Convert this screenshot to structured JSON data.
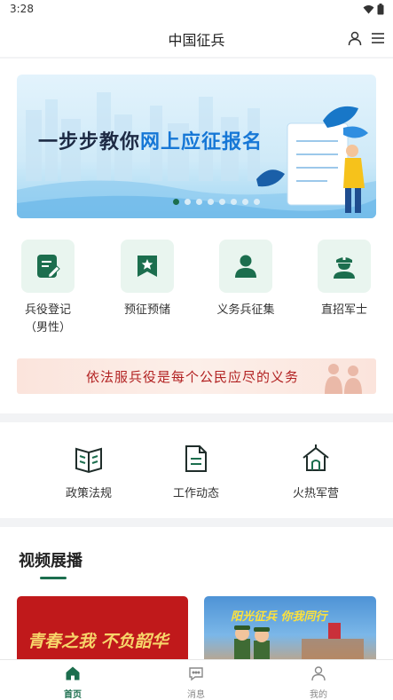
{
  "status_bar": {
    "time": "3:28"
  },
  "header": {
    "title": "中国征兵"
  },
  "banner": {
    "title_part1": "一步步教你",
    "title_part2": "网上应征报名"
  },
  "quick_links": [
    {
      "label": "兵役登记",
      "sub_label": "（男性）",
      "icon": "registration-edit-icon"
    },
    {
      "label": "预征预储",
      "icon": "bookmark-star-icon"
    },
    {
      "label": "义务兵征集",
      "icon": "soldier-person-icon"
    },
    {
      "label": "直招军士",
      "icon": "officer-cap-icon"
    }
  ],
  "slogan": {
    "text": "依法服兵役是每个公民应尽的义务"
  },
  "nav": [
    {
      "label": "政策法规",
      "icon": "book-icon"
    },
    {
      "label": "工作动态",
      "icon": "document-icon"
    },
    {
      "label": "火热军营",
      "icon": "barracks-house-icon"
    }
  ],
  "video_section": {
    "title": "视频展播",
    "videos": [
      {
        "caption": "青春之我 不负韶华"
      },
      {
        "caption": "阳光征兵 你我同行"
      }
    ]
  },
  "tab_bar": [
    {
      "label": "首页",
      "icon": "home-icon",
      "active": true
    },
    {
      "label": "消息",
      "icon": "message-icon",
      "active": false
    },
    {
      "label": "我的",
      "icon": "profile-icon",
      "active": false
    }
  ],
  "colors": {
    "brand_green": "#1c6e4e",
    "icon_bg": "#e9f5ef",
    "slogan_red": "#b22222"
  }
}
